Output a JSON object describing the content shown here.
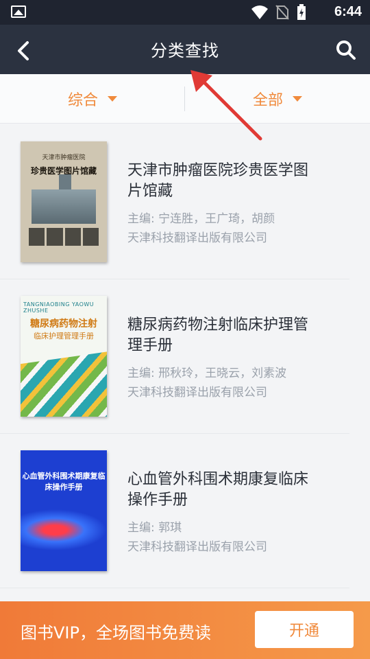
{
  "status_bar": {
    "time": "6:44"
  },
  "nav": {
    "title": "分类查找"
  },
  "filters": {
    "left": "综合",
    "right": "全部"
  },
  "books": [
    {
      "title": "天津市肿瘤医院珍贵医学图片馆藏",
      "editor": "主编: 宁连胜，王广琦，胡颜",
      "publisher": "天津科技翻译出版有限公司",
      "cover_top": "天津市肿瘤医院",
      "cover_main": "珍贵医学图片馆藏"
    },
    {
      "title": "糖尿病药物注射临床护理管理手册",
      "editor": "主编: 邢秋玲，王晓云，刘素波",
      "publisher": "天津科技翻译出版有限公司",
      "cover_top": "TANGNIAOBING YAOWU ZHUSHE",
      "cover_main": "糖尿病药物注射",
      "cover_sub": "临床护理管理手册"
    },
    {
      "title": "心血管外科围术期康复临床操作手册",
      "editor": "主编: 郭琪",
      "publisher": "天津科技翻译出版有限公司",
      "cover_main": "心血管外科围术期康复临床操作手册"
    }
  ],
  "promo": {
    "text": "图书VIP，全场图书免费读",
    "button": "开通"
  },
  "colors": {
    "accent": "#f08a3c",
    "nav_bg": "#2b3240",
    "annotation": "#e03a35"
  }
}
